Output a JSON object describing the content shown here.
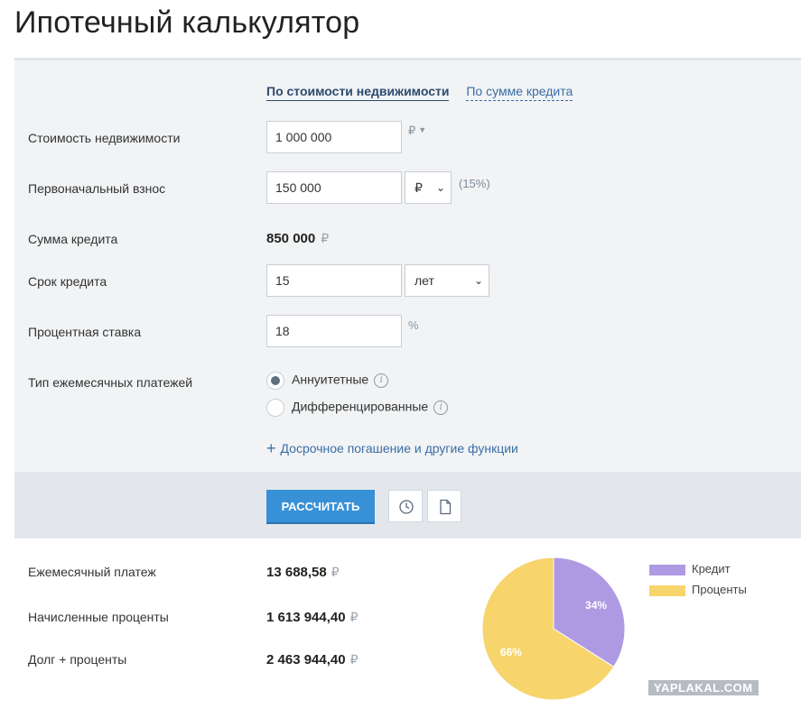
{
  "title": "Ипотечный калькулятор",
  "tabs": [
    {
      "label": "По стоимости недвижимости",
      "active": true
    },
    {
      "label": "По сумме кредита",
      "active": false
    }
  ],
  "form": {
    "property_cost": {
      "label": "Стоимость недвижимости",
      "value": "1 000 000",
      "unit": "₽"
    },
    "down_payment": {
      "label": "Первоначальный взнос",
      "value": "150 000",
      "unit_select": "₽",
      "percent_note": "(15%)"
    },
    "loan_amount": {
      "label": "Сумма кредита",
      "value": "850 000",
      "unit": "₽"
    },
    "term": {
      "label": "Срок кредита",
      "value": "15",
      "unit_select": "лет"
    },
    "rate": {
      "label": "Процентная ставка",
      "value": "18",
      "unit": "%"
    },
    "payment_type": {
      "label": "Тип ежемесячных платежей",
      "options": [
        {
          "label": "Аннуитетные",
          "selected": true
        },
        {
          "label": "Дифференцированные",
          "selected": false
        }
      ]
    },
    "more_link": "Досрочное погашение и другие функции"
  },
  "actions": {
    "calculate_label": "РАССЧИТАТЬ",
    "history_icon": "clock-icon",
    "document_icon": "document-icon"
  },
  "results": {
    "monthly": {
      "label": "Ежемесячный платеж",
      "value": "13 688,58",
      "unit": "₽"
    },
    "interest": {
      "label": "Начисленные проценты",
      "value": "1 613 944,40",
      "unit": "₽"
    },
    "total": {
      "label": "Долг + проценты",
      "value": "2 463 944,40",
      "unit": "₽"
    }
  },
  "chart_data": {
    "type": "pie",
    "slices": [
      {
        "name": "Кредит",
        "value": 34,
        "label": "34%",
        "color": "#ae9ae2"
      },
      {
        "name": "Проценты",
        "value": 66,
        "label": "66%",
        "color": "#f7d46c"
      }
    ]
  },
  "watermark": "YAPLAKAL.COM"
}
